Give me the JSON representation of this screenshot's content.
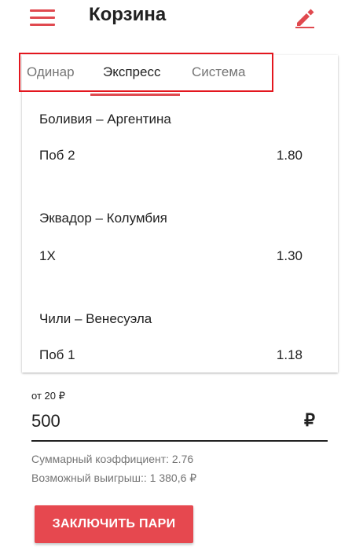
{
  "header": {
    "title": "Корзина",
    "menu_icon": "hamburger-menu-icon",
    "edit_icon": "pencil-icon",
    "accent_color": "#e0494f"
  },
  "tabs": [
    {
      "label": "Одинар",
      "active": false
    },
    {
      "label": "Экспресс",
      "active": true
    },
    {
      "label": "Система",
      "active": false
    }
  ],
  "bets": [
    {
      "match": "Боливия – Аргентина",
      "outcome": "Поб 2",
      "odds": "1.80"
    },
    {
      "match": "Эквадор – Колумбия",
      "outcome": "1X",
      "odds": "1.30"
    },
    {
      "match": "Чили – Венесуэла",
      "outcome": "Поб 1",
      "odds": "1.18"
    }
  ],
  "stake": {
    "min_label": "от 20 ₽",
    "value": "500",
    "currency": "₽"
  },
  "summary": {
    "total_coef": "Суммарный коэффициент: 2.76",
    "possible_win": "Возможный выигрыш:: 1 380,6 ₽"
  },
  "submit_button": {
    "label": "ЗАКЛЮЧИТЬ ПАРИ",
    "color": "#e6484f"
  },
  "highlight_color": "#e3161e"
}
